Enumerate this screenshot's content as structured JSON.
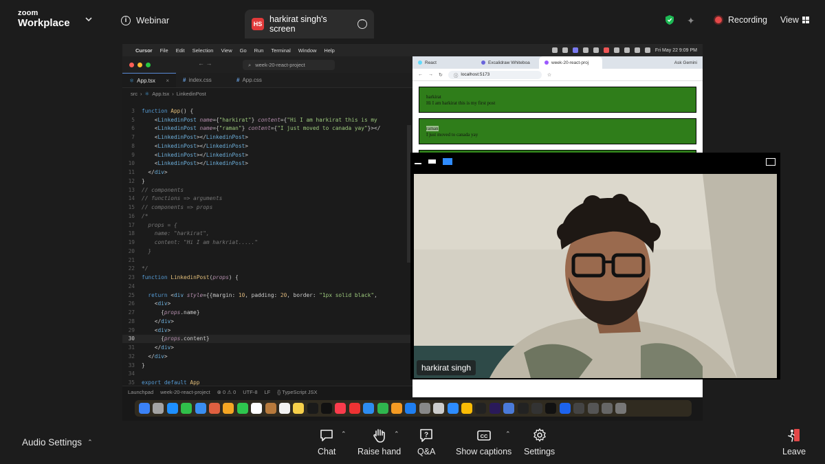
{
  "zoom": {
    "brand_top": "zoom",
    "brand_bottom": "Workplace",
    "mode": "Webinar",
    "share_initials": "HS",
    "share_title": "harkirat singh's screen",
    "recording": "Recording",
    "view": "View",
    "audio_settings": "Audio Settings",
    "controls": {
      "chat": "Chat",
      "raise_hand": "Raise hand",
      "qa": "Q&A",
      "captions": "Show captions",
      "settings": "Settings",
      "leave": "Leave"
    }
  },
  "mac": {
    "menu": [
      "Cursor",
      "File",
      "Edit",
      "Selection",
      "View",
      "Go",
      "Run",
      "Terminal",
      "Window",
      "Help"
    ],
    "clock": "Fri May 22  9:09 PM"
  },
  "editor": {
    "search": "week-20-react-project",
    "tabs": [
      "App.tsx",
      "index.css",
      "App.css"
    ],
    "breadcrumb": [
      "src",
      "App.tsx",
      "LinkedinPost"
    ],
    "status": [
      "Launchpad",
      "week-20-react-project",
      "⊗ 0  ⚠ 0",
      "UTF-8",
      "LF",
      "{} TypeScript JSX"
    ]
  },
  "browser": {
    "tabs": [
      "React",
      "Excalidraw Whiteboa",
      "week-20-react-proj",
      "Ask Gemini"
    ],
    "url": "localhost:5173",
    "posts": [
      {
        "name": "harkirat",
        "content": "Hi I am harkirat this is my first post"
      },
      {
        "name": "raman",
        "content": "I just moved to canada yay"
      }
    ]
  },
  "webcam": {
    "name": "harkirat singh"
  }
}
